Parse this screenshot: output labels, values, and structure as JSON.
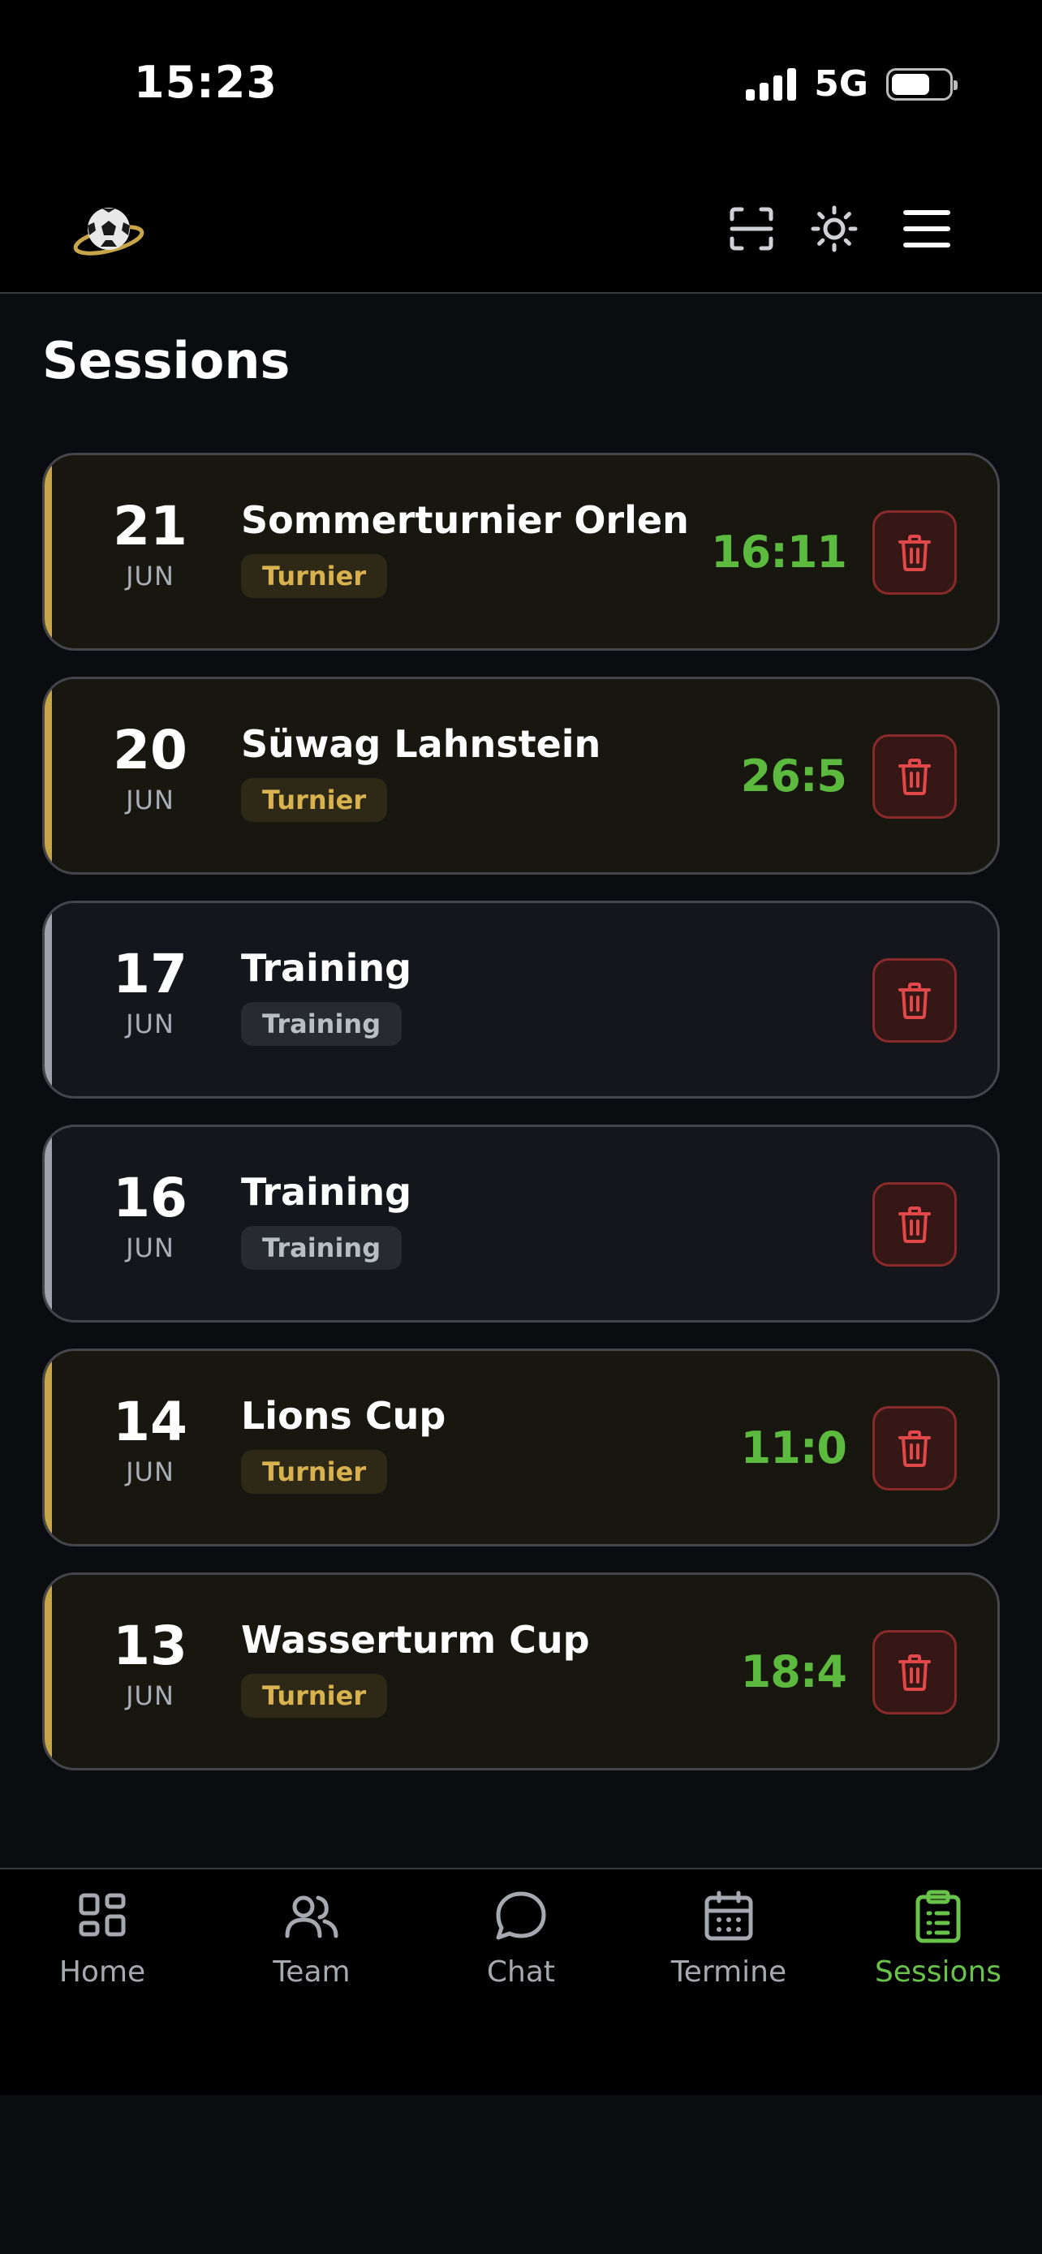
{
  "status_bar": {
    "time": "15:23",
    "network": "5G"
  },
  "page": {
    "title": "Sessions"
  },
  "colors": {
    "accent_gold": "#c9a54a",
    "score_green": "#5cba3f",
    "delete_red": "#e0484a",
    "active_nav": "#69c24a"
  },
  "sessions": [
    {
      "day": "21",
      "month": "JUN",
      "name": "Sommerturnier Orlen",
      "type": "Turnier",
      "kind": "tournament",
      "score": "16:11"
    },
    {
      "day": "20",
      "month": "JUN",
      "name": "Süwag Lahnstein",
      "type": "Turnier",
      "kind": "tournament",
      "score": "26:5"
    },
    {
      "day": "17",
      "month": "JUN",
      "name": "Training",
      "type": "Training",
      "kind": "training",
      "score": ""
    },
    {
      "day": "16",
      "month": "JUN",
      "name": "Training",
      "type": "Training",
      "kind": "training",
      "score": ""
    },
    {
      "day": "14",
      "month": "JUN",
      "name": "Lions Cup",
      "type": "Turnier",
      "kind": "tournament",
      "score": "11:0"
    },
    {
      "day": "13",
      "month": "JUN",
      "name": "Wasserturm Cup",
      "type": "Turnier",
      "kind": "tournament",
      "score": "18:4"
    }
  ],
  "nav": {
    "items": [
      {
        "label": "Home",
        "icon": "grid-icon"
      },
      {
        "label": "Team",
        "icon": "users-icon"
      },
      {
        "label": "Chat",
        "icon": "chat-bubble-icon"
      },
      {
        "label": "Termine",
        "icon": "calendar-icon"
      },
      {
        "label": "Sessions",
        "icon": "clipboard-icon"
      }
    ],
    "active": "Sessions"
  }
}
